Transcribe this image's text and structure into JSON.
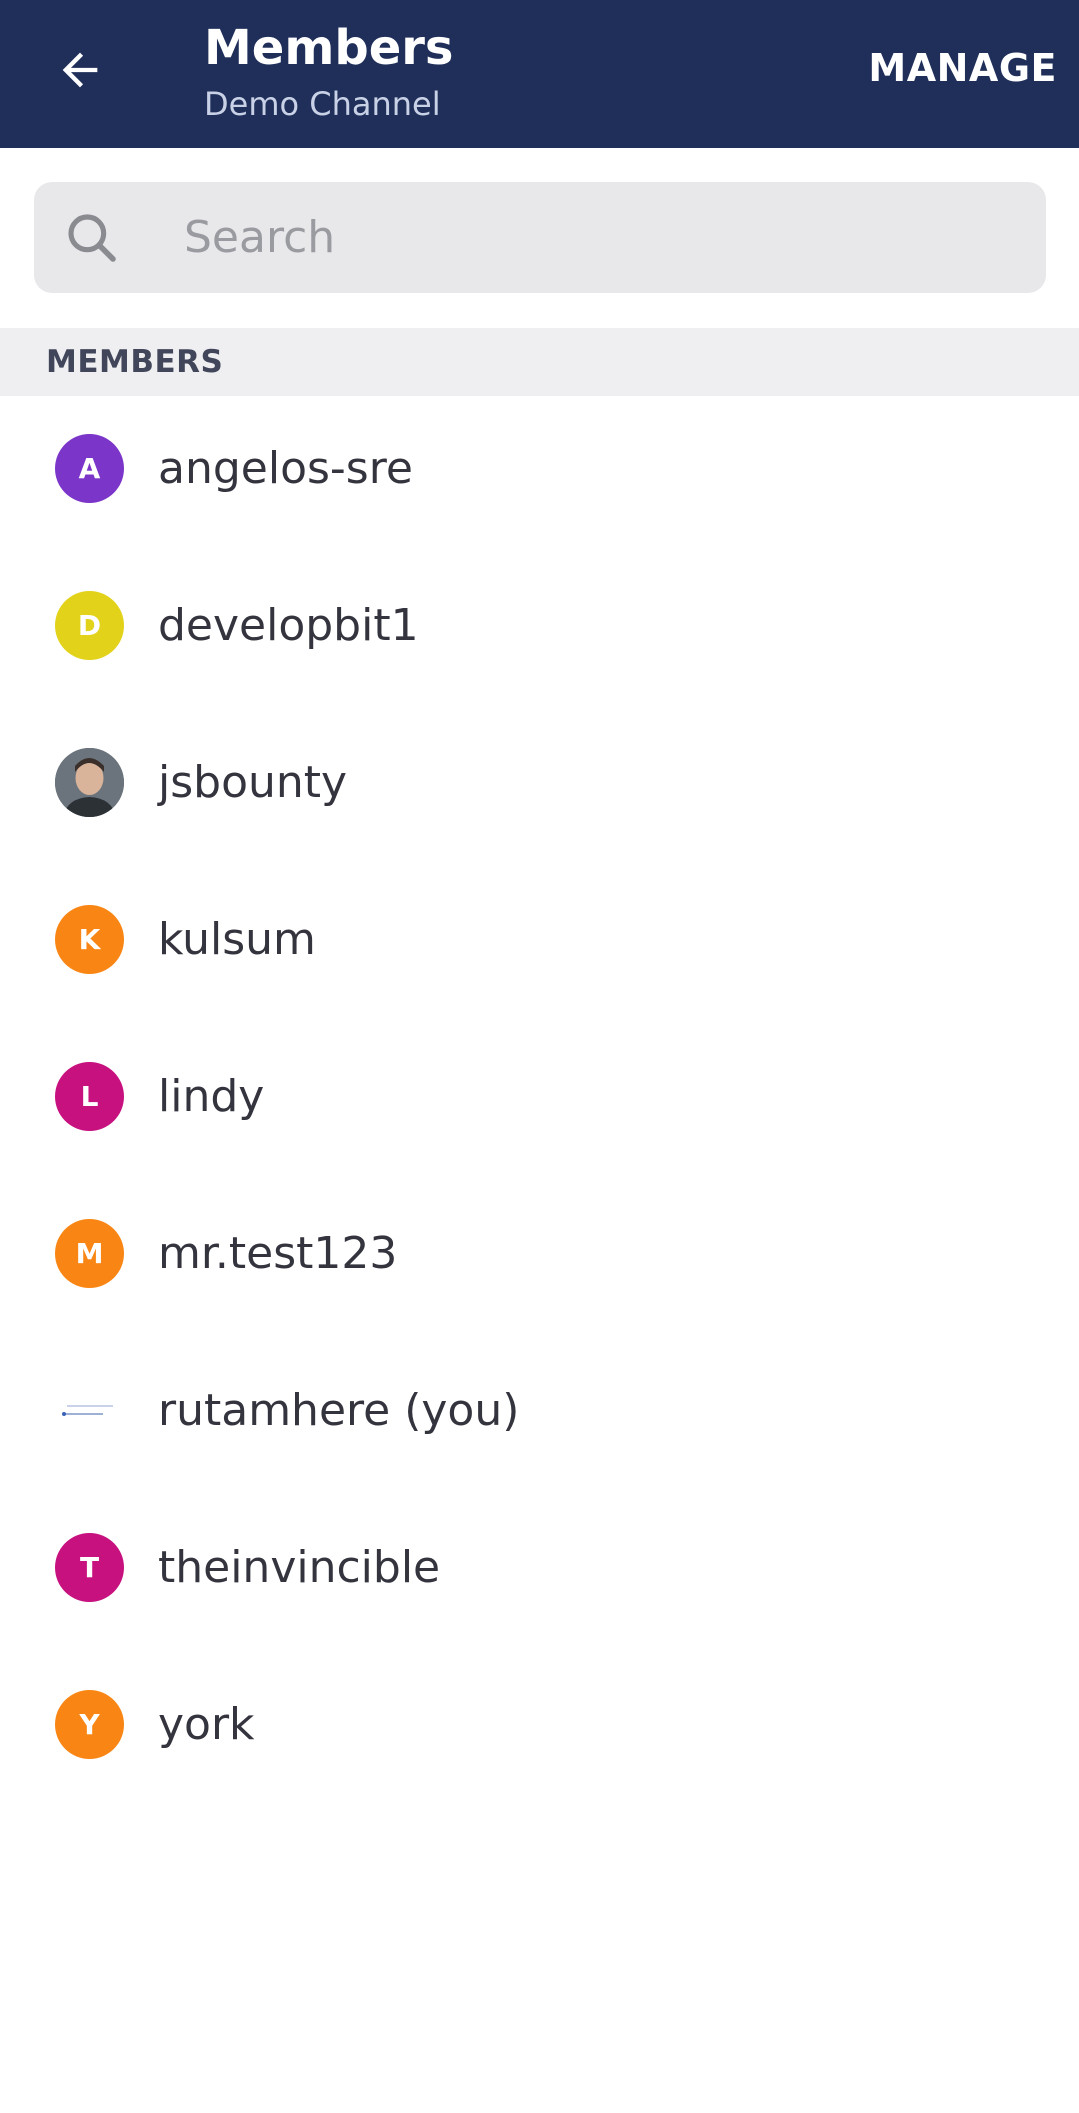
{
  "header": {
    "title": "Members",
    "subtitle": "Demo Channel",
    "manage_label": "MANAGE",
    "background": "#1f2f5a"
  },
  "search": {
    "placeholder": "Search",
    "value": ""
  },
  "section": {
    "label": "MEMBERS"
  },
  "members": [
    {
      "name": "angelos-sre",
      "initial": "A",
      "avatar_color": "#7b35c9",
      "avatar_type": "initial"
    },
    {
      "name": "developbit1",
      "initial": "D",
      "avatar_color": "#e2d21a",
      "avatar_type": "initial"
    },
    {
      "name": "jsbounty",
      "initial": "",
      "avatar_color": "#5a636b",
      "avatar_type": "photo"
    },
    {
      "name": "kulsum",
      "initial": "K",
      "avatar_color": "#f98614",
      "avatar_type": "initial"
    },
    {
      "name": "lindy",
      "initial": "L",
      "avatar_color": "#c7117f",
      "avatar_type": "initial"
    },
    {
      "name": "mr.test123",
      "initial": "M",
      "avatar_color": "#f98614",
      "avatar_type": "initial"
    },
    {
      "name": "rutamhere (you)",
      "initial": "",
      "avatar_color": "#ffffff",
      "avatar_type": "image"
    },
    {
      "name": "theinvincible",
      "initial": "T",
      "avatar_color": "#c7117f",
      "avatar_type": "initial"
    },
    {
      "name": "york",
      "initial": "Y",
      "avatar_color": "#f98614",
      "avatar_type": "initial"
    }
  ]
}
